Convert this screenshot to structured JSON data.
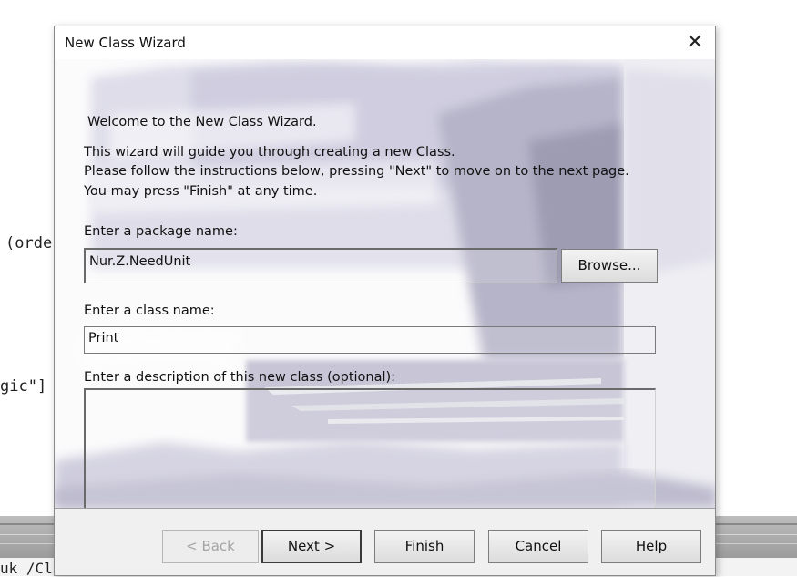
{
  "background_code": {
    "line1": "(orde",
    "line2": "gic\"]",
    "line3": "uk /Cl"
  },
  "dialog": {
    "title": "New Class Wizard",
    "close_symbol": "✕",
    "welcome": "Welcome to the New Class Wizard.",
    "intro_lines": [
      "This wizard will guide you through creating a new  Class.",
      "Please follow the instructions below, pressing \"Next\" to move on to the next page.",
      "You may press \"Finish\" at any time."
    ],
    "package_label": "Enter a package name:",
    "package_value": "Nur.Z.NeedUnit",
    "browse_label": "Browse...",
    "class_label": "Enter a class name:",
    "class_value": "Print",
    "description_label": "Enter a description of this new class (optional):",
    "description_value": ""
  },
  "buttons": {
    "back": "< Back",
    "next": "Next >",
    "finish": "Finish",
    "cancel": "Cancel",
    "help": "Help"
  }
}
